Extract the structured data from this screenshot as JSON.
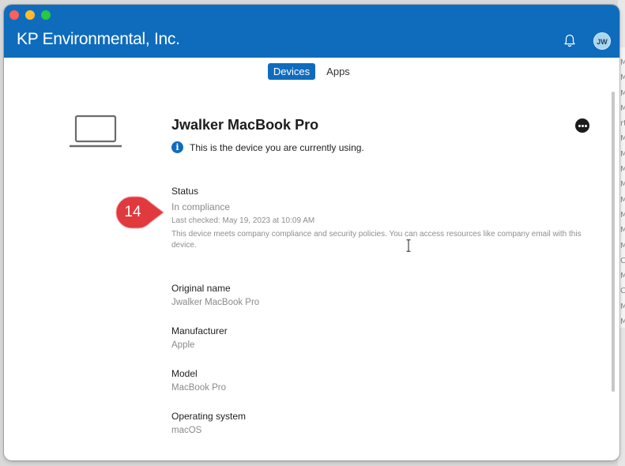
{
  "window": {
    "app_title": "KP Environmental, Inc.",
    "avatar_initials": "JW"
  },
  "tabs": [
    {
      "label": "Devices",
      "selected": true
    },
    {
      "label": "Apps",
      "selected": false
    }
  ],
  "device": {
    "title": "Jwalker MacBook Pro",
    "current_device_note": "This is the device you are currently using.",
    "status": {
      "label": "Status",
      "value": "In compliance",
      "last_checked": "Last checked: May 19, 2023 at 10:09 AM",
      "description": "This device meets company compliance and security policies. You can access resources like company email with this device."
    },
    "details": [
      {
        "label": "Original name",
        "value": "Jwalker MacBook Pro"
      },
      {
        "label": "Manufacturer",
        "value": "Apple"
      },
      {
        "label": "Model",
        "value": "MacBook Pro"
      },
      {
        "label": "Operating system",
        "value": "macOS"
      }
    ]
  },
  "callout": {
    "number": "14"
  },
  "background_window": {
    "letters": [
      "M",
      "M",
      "M",
      "M",
      "rt",
      "M",
      "M",
      "M",
      "M",
      "M",
      "M",
      "M",
      "M",
      "C",
      "M",
      "C",
      "M",
      "M"
    ]
  },
  "colors": {
    "accent": "#0f6cbd",
    "callout": "#e0393e"
  }
}
